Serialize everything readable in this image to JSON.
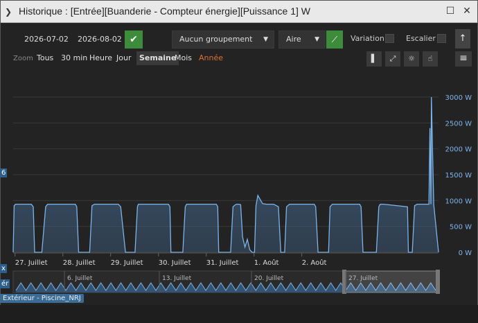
{
  "background": {
    "side_tab_top": "6",
    "side_tab_mid1": "x",
    "side_tab_mid2": "ér",
    "bottom_tag": "Extérieur - Piscine_NRJ"
  },
  "window": {
    "title": "Historique : [Entrée][Buanderie - Compteur énergie][Puissance 1] W",
    "title_icon": "history-icon",
    "maximize_icon": "maximize-icon",
    "close_icon": "close-icon"
  },
  "toolbar": {
    "date_start": "2026-07-02",
    "date_end": "2026-08-02",
    "grouping": "Aucun groupement",
    "chart_type": "Aire",
    "variation_label": "Variation",
    "variation_checked": false,
    "stair_label": "Escalier",
    "stair_checked": false
  },
  "zoom": {
    "label": "Zoom",
    "buttons": [
      "Tous",
      "30 min",
      "Heure",
      "Jour",
      "Semaine",
      "Mois",
      "Année"
    ],
    "active": "Semaine"
  },
  "colors": {
    "series_line": "#7cb5ec",
    "series_fill": "#3f5e80",
    "accent_green": "#3c8c3c",
    "year_orange": "#e07030",
    "axis_label": "#7cb5ec",
    "grid": "#3a3a3a"
  },
  "chart_data": {
    "type": "area",
    "unit": "W",
    "ylim": [
      0,
      3000
    ],
    "y_ticks": [
      "3000 W",
      "2500 W",
      "2000 W",
      "1500 W",
      "1000 W",
      "500 W",
      "0 W"
    ],
    "x_ticks": [
      "27. Juillet",
      "28. Juillet",
      "29. Juillet",
      "30. Juillet",
      "31. Juillet",
      "1. Août",
      "2. Août"
    ],
    "navigator_ticks": [
      "6. Juillet",
      "13. Juillet",
      "20. Juillet",
      "27. Juillet"
    ],
    "grid": true,
    "series": [
      {
        "x_days": [
          26.0,
          26.02,
          26.05,
          26.38,
          26.42,
          26.45,
          26.6,
          26.68,
          26.72,
          26.75,
          26.78,
          27.3,
          27.33,
          27.37,
          27.45,
          27.6,
          27.65,
          27.7,
          27.72,
          27.75,
          28.2,
          28.25,
          28.35,
          28.5,
          28.55,
          28.6,
          28.62,
          28.65,
          29.25,
          29.28,
          29.3,
          29.35,
          29.4,
          29.55,
          29.6,
          29.63,
          29.65,
          29.68,
          30.25,
          30.28,
          30.3,
          30.35,
          30.4,
          30.55,
          30.6,
          30.65,
          30.68,
          30.72,
          30.76,
          30.8,
          30.85,
          30.9,
          30.95,
          31.0,
          31.05,
          31.08,
          31.12,
          31.18,
          31.22,
          31.3,
          31.45,
          31.55,
          31.6,
          31.65,
          31.68,
          31.72,
          31.78,
          31.82,
          32.3,
          32.33,
          32.38,
          32.45,
          32.55,
          32.6,
          32.63,
          32.68,
          32.72,
          33.25,
          33.28,
          33.32,
          33.4,
          33.55,
          33.6,
          33.65,
          33.68,
          33.7,
          33.72,
          33.75,
          34.25,
          34.27,
          34.28,
          34.3,
          34.35,
          34.4,
          34.45,
          34.55,
          34.6,
          34.7,
          34.72,
          34.74,
          34.75,
          34.8,
          34.9
        ],
        "values": [
          0,
          900,
          930,
          930,
          880,
          0,
          0,
          880,
          930,
          930,
          930,
          930,
          880,
          0,
          0,
          0,
          900,
          930,
          930,
          930,
          930,
          880,
          0,
          0,
          0,
          880,
          930,
          930,
          930,
          880,
          0,
          0,
          0,
          0,
          880,
          930,
          930,
          930,
          930,
          880,
          0,
          0,
          0,
          0,
          880,
          920,
          930,
          930,
          920,
          300,
          100,
          250,
          50,
          0,
          0,
          900,
          1100,
          1000,
          940,
          930,
          930,
          880,
          0,
          0,
          0,
          880,
          930,
          930,
          930,
          880,
          0,
          0,
          0,
          0,
          880,
          930,
          930,
          930,
          880,
          0,
          0,
          0,
          0,
          880,
          930,
          930,
          930,
          930,
          880,
          0,
          0,
          0,
          0,
          900,
          930,
          930,
          930,
          930,
          2400,
          930,
          3000,
          930,
          0
        ]
      }
    ]
  }
}
